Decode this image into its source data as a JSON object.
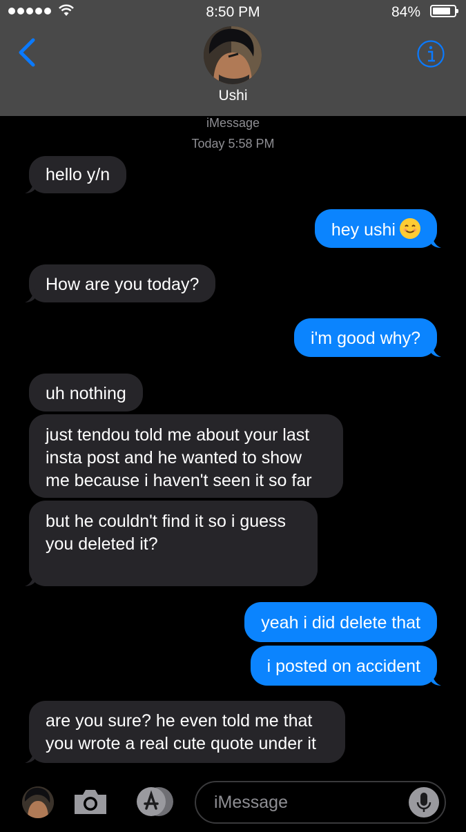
{
  "status_bar": {
    "time": "8:50 PM",
    "battery": "84%",
    "battery_level": 0.84
  },
  "header": {
    "contact_name": "Ushi",
    "back_icon": "chevron-left-icon",
    "info_icon": "info-icon"
  },
  "conversation": {
    "service": "iMessage",
    "timestamp": "Today 5:58 PM",
    "messages": [
      {
        "from": "them",
        "text": "hello y/n"
      },
      {
        "from": "me",
        "text": "hey ushi",
        "emoji": "smiling-face-emoji"
      },
      {
        "from": "them",
        "text": "How are you today?"
      },
      {
        "from": "me",
        "text": "i'm good why?"
      },
      {
        "from": "them",
        "text": "uh nothing"
      },
      {
        "from": "them",
        "lines": [
          "just tendou told me about your last",
          "insta post and he wanted to show",
          "me because i haven't seen it so far"
        ]
      },
      {
        "from": "them",
        "lines": [
          "but he couldn't find it so i guess",
          "you deleted it?"
        ]
      },
      {
        "from": "me",
        "text": "yeah i did delete that"
      },
      {
        "from": "me",
        "text": "i posted on accident"
      },
      {
        "from": "them",
        "lines": [
          "are you sure? he even told me that",
          "you wrote a real cute quote under it"
        ]
      }
    ]
  },
  "compose": {
    "placeholder": "iMessage",
    "camera_icon": "camera-icon",
    "apps_icon": "app-store-icon",
    "mic_icon": "microphone-icon"
  },
  "colors": {
    "header_bg": "#494949",
    "incoming_bubble": "#262529",
    "outgoing_bubble": "#0b84fe",
    "accent": "#0a7aff",
    "secondary_text": "#8e8e93"
  }
}
